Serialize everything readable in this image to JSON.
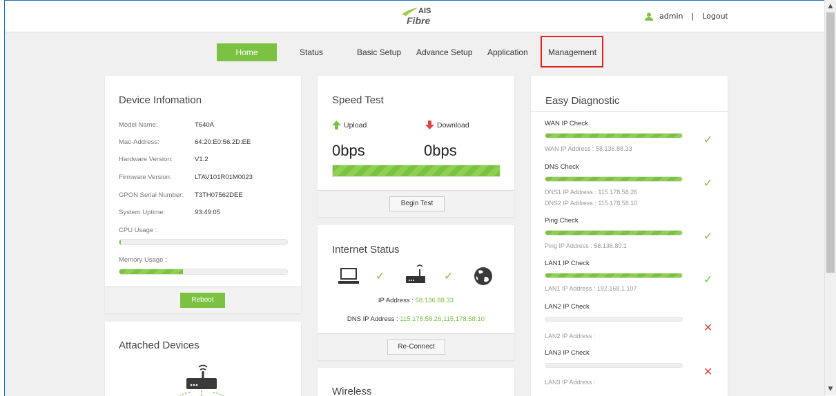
{
  "header": {
    "logo_top": "AIS",
    "logo_bottom": "Fibre",
    "user_name": "admin",
    "separator": "|",
    "logout_label": "Logout"
  },
  "nav": {
    "items": [
      {
        "label": "Home"
      },
      {
        "label": "Status"
      },
      {
        "label": "Basic Setup"
      },
      {
        "label": "Advance Setup"
      },
      {
        "label": "Application"
      },
      {
        "label": "Management"
      }
    ]
  },
  "device_info": {
    "title": "Device Infomation",
    "rows": [
      {
        "label": "Model Name:",
        "value": "T640A"
      },
      {
        "label": "Mac-Address:",
        "value": "64:20:E0:56:2D:EE"
      },
      {
        "label": "Hardware Version:",
        "value": "V1.2"
      },
      {
        "label": "Firmware Version:",
        "value": "LTAV101R01M0023"
      },
      {
        "label": "GPON Serial Number:",
        "value": "T3TH07562DEE"
      },
      {
        "label": "System Uptime:",
        "value": "93:49:05"
      }
    ],
    "cpu_label": "CPU Usage :",
    "cpu_fraction": 0.01,
    "memory_label": "Memory Usage :",
    "memory_fraction": 0.38,
    "reboot_label": "Reboot"
  },
  "attached_devices": {
    "title": "Attached Devices"
  },
  "speed_test": {
    "title": "Speed Test",
    "upload_label": "Upload",
    "download_label": "Download",
    "upload_value": "0bps",
    "download_value": "0bps",
    "progress_fraction": 1.0,
    "begin_label": "Begin Test"
  },
  "internet_status": {
    "title": "Internet Status",
    "ip_label": "IP Address :",
    "ip_value": "58.136.88.33",
    "dns_label": "DNS IP Address :",
    "dns_value": "115.178.58.26,115.178.58.10",
    "reconnect_label": "Re-Connect"
  },
  "wireless": {
    "title": "Wireless"
  },
  "easy_diag": {
    "title": "Easy Diagnostic",
    "checks": [
      {
        "label": "WAN IP Check",
        "status": "ok",
        "fraction": 1.0,
        "lines": [
          "WAN IP Address : 58.136.88.33"
        ]
      },
      {
        "label": "DNS Check",
        "status": "ok",
        "fraction": 1.0,
        "lines": [
          "DNS1 IP Address : 115.178.58.26",
          "DNS2 IP Address : 115.178.58.10"
        ]
      },
      {
        "label": "Ping Check",
        "status": "ok",
        "fraction": 1.0,
        "lines": [
          "Ping IP Address : 58.136.80.1"
        ]
      },
      {
        "label": "LAN1 IP Check",
        "status": "ok",
        "fraction": 1.0,
        "lines": [
          "LAN1 IP Address : 192.168.1.107"
        ]
      },
      {
        "label": "LAN2 IP Check",
        "status": "fail",
        "fraction": 0,
        "lines": [
          "LAN2 IP Address :"
        ]
      },
      {
        "label": "LAN3 IP Check",
        "status": "fail",
        "fraction": 0,
        "lines": [
          "LAN3 IP Address :"
        ]
      }
    ]
  },
  "colors": {
    "accent": "#7cc242",
    "error": "#e04545",
    "highlight_box": "#e02020"
  }
}
